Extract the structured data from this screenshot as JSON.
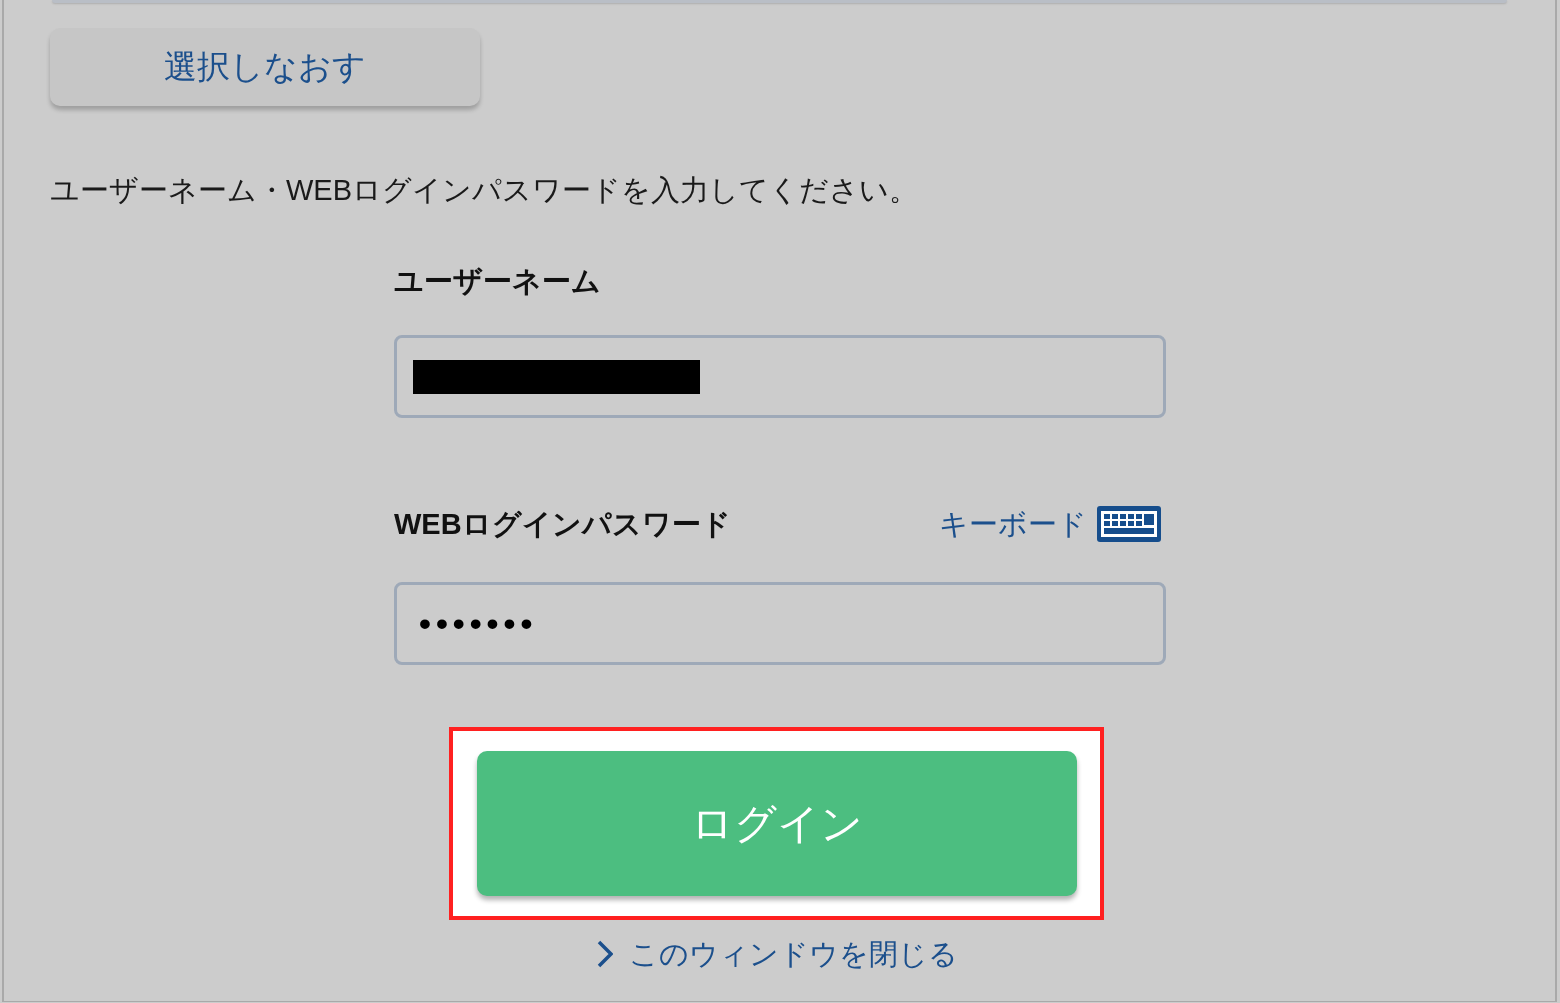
{
  "reselect_button": {
    "label": "選択しなおす"
  },
  "instruction": "ユーザーネーム・WEBログインパスワードを入力してください。",
  "username": {
    "label": "ユーザーネーム",
    "value_redacted": true
  },
  "password": {
    "label": "WEBログインパスワード",
    "keyboard_link": "キーボード",
    "value": "•••••••"
  },
  "login_button": {
    "label": "ログイン",
    "highlighted": true
  },
  "close_link": {
    "label": "このウィンドウを閉じる"
  }
}
